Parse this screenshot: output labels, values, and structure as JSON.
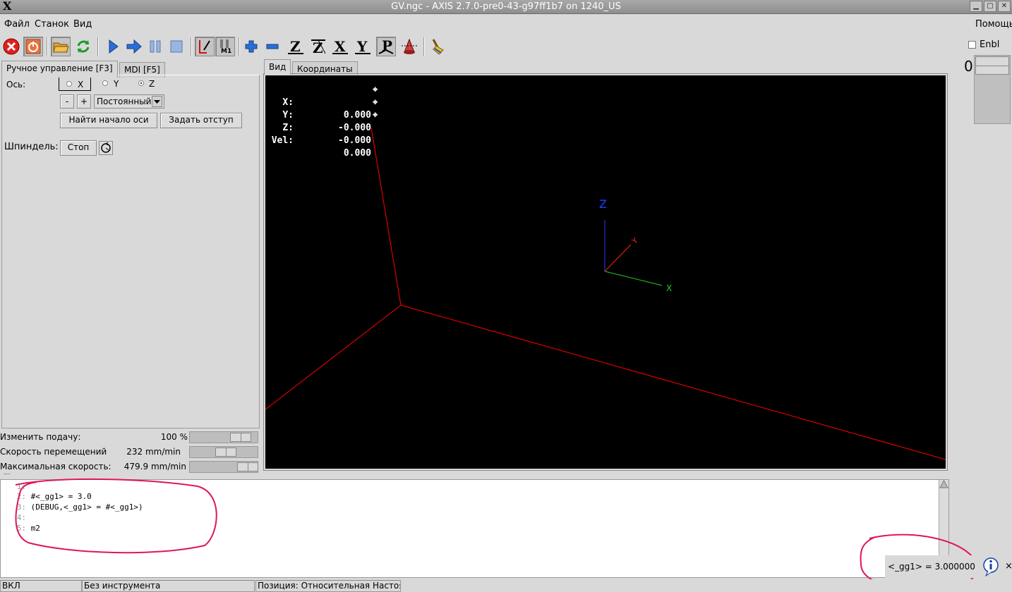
{
  "window": {
    "title": "GV.ngc - AXIS 2.7.0-pre0-43-g97ff1b7 on 1240_US",
    "logo": "X",
    "buttons": [
      "minimize",
      "maximize",
      "close"
    ]
  },
  "menu": {
    "items": [
      "Файл",
      "Станок",
      "Вид"
    ],
    "help": "Помощь"
  },
  "toolbar": {
    "icons": [
      "estop-icon",
      "machine-power-icon",
      "open-file-icon",
      "reload-icon",
      "run-icon",
      "step-icon",
      "pause-icon",
      "stop-icon",
      "block-delete-icon",
      "optional-stop-icon",
      "zoom-in-icon",
      "zoom-out-icon",
      "view-z-icon",
      "view-z2-icon",
      "view-x-icon",
      "view-y-icon",
      "view-p-icon",
      "rotate-view-icon",
      "clear-plot-icon"
    ],
    "labels": {
      "m1": "M1",
      "z": "Z",
      "z2": "Z",
      "x": "X",
      "y": "Y",
      "p": "P"
    }
  },
  "enbl": {
    "label": "Enbl",
    "checked": false,
    "jog_value": "0"
  },
  "left_tabs": [
    "Ручное управление [F3]",
    "MDI [F5]"
  ],
  "manual": {
    "axis_label": "Ось:",
    "axes": [
      "X",
      "Y",
      "Z"
    ],
    "selected_axis": "Z",
    "minus": "-",
    "plus": "+",
    "jog_mode": "Постоянный",
    "home_button": "Найти начало оси",
    "touch_off_button": "Задать отступ",
    "spindle_label": "Шпиндель:",
    "spindle_stop": "Стоп"
  },
  "overrides": [
    {
      "label": "Изменить подачу:",
      "value": "100 %",
      "position": 0.85
    },
    {
      "label": "Скорость перемещений",
      "value": "232 mm/min",
      "position": 0.55
    },
    {
      "label": "Максимальная скорость:",
      "value": "479.9 mm/min",
      "position": 0.97
    }
  ],
  "view_tabs": [
    "Вид",
    "Координаты"
  ],
  "dro": [
    {
      "axis": "X:",
      "value": "0.000"
    },
    {
      "axis": "Y:",
      "value": "-0.000"
    },
    {
      "axis": "Z:",
      "value": "-0.000"
    },
    {
      "axis": "Vel:",
      "value": "0.000"
    }
  ],
  "axes_labels": {
    "x": "X",
    "y": "Y",
    "z": "Z"
  },
  "gcode": [
    {
      "no": "1:",
      "text": ""
    },
    {
      "no": "2:",
      "text": "#<_gg1> = 3.0"
    },
    {
      "no": "3:",
      "text": "(DEBUG,<_gg1> = #<_gg1>)"
    },
    {
      "no": "4:",
      "text": ""
    },
    {
      "no": "5:",
      "text": "m2"
    }
  ],
  "status": {
    "state": "ВКЛ",
    "tool": "Без инструмента",
    "position": "Позиция: Относительная Настоящая"
  },
  "notification": {
    "text": "<_gg1> = 3.000000",
    "icon": "info-icon",
    "close": "×"
  },
  "colors": {
    "preview_bg": "#000000",
    "limit_lines": "#ff0000",
    "annotation": "#e0155a",
    "axis_x": "#00c000",
    "axis_y": "#ff2020",
    "axis_z": "#2040ff"
  }
}
